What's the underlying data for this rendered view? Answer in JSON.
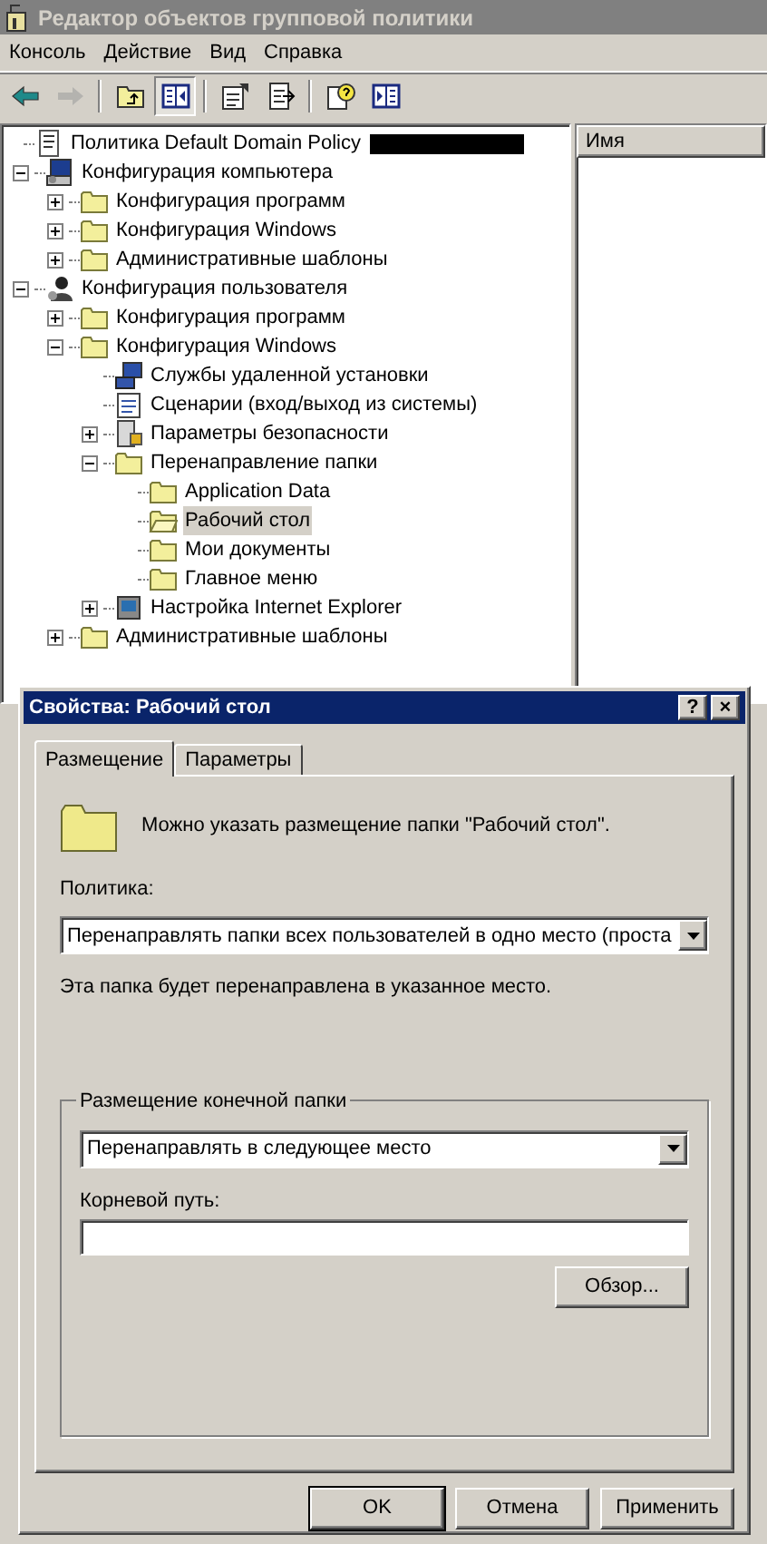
{
  "window": {
    "title": "Редактор объектов групповой политики"
  },
  "menu": [
    "Консоль",
    "Действие",
    "Вид",
    "Справка"
  ],
  "toolbar": [
    {
      "kind": "back",
      "disabled": false
    },
    {
      "kind": "forward",
      "disabled": true
    },
    {
      "kind": "sep"
    },
    {
      "kind": "up",
      "disabled": false
    },
    {
      "kind": "tree",
      "disabled": false,
      "pressed": true
    },
    {
      "kind": "sep"
    },
    {
      "kind": "props",
      "disabled": false
    },
    {
      "kind": "export",
      "disabled": false
    },
    {
      "kind": "sep"
    },
    {
      "kind": "help",
      "disabled": false
    },
    {
      "kind": "panel",
      "disabled": false
    }
  ],
  "tree": [
    {
      "label": "Политика Default Domain Policy",
      "kind": "policy",
      "redacted": true,
      "selected": false,
      "children": [
        {
          "label": "Конфигурация компьютера",
          "kind": "computer",
          "expanded": true,
          "selected": false,
          "children": [
            {
              "label": "Конфигурация программ",
              "kind": "folder",
              "expanded": false,
              "selected": false
            },
            {
              "label": "Конфигурация Windows",
              "kind": "folder",
              "expanded": false,
              "selected": false
            },
            {
              "label": "Административные шаблоны",
              "kind": "folder",
              "expanded": false,
              "selected": false
            }
          ]
        },
        {
          "label": "Конфигурация пользователя",
          "kind": "user",
          "expanded": true,
          "selected": false,
          "children": [
            {
              "label": "Конфигурация программ",
              "kind": "folder",
              "expanded": false,
              "selected": false
            },
            {
              "label": "Конфигурация Windows",
              "kind": "folder",
              "expanded": true,
              "selected": false,
              "children": [
                {
                  "label": "Службы удаленной установки",
                  "kind": "remote",
                  "selected": false
                },
                {
                  "label": "Сценарии (вход/выход из системы)",
                  "kind": "script",
                  "selected": false
                },
                {
                  "label": "Параметры безопасности",
                  "kind": "security",
                  "expanded": false,
                  "selected": false
                },
                {
                  "label": "Перенаправление папки",
                  "kind": "folder",
                  "expanded": true,
                  "selected": false,
                  "children": [
                    {
                      "label": "Application Data",
                      "kind": "folder",
                      "selected": false
                    },
                    {
                      "label": "Рабочий стол",
                      "kind": "folder",
                      "selected": true
                    },
                    {
                      "label": "Мои документы",
                      "kind": "folder",
                      "selected": false
                    },
                    {
                      "label": "Главное меню",
                      "kind": "folder",
                      "selected": false
                    }
                  ]
                },
                {
                  "label": "Настройка Internet Explorer",
                  "kind": "ie",
                  "expanded": false,
                  "selected": false
                }
              ]
            },
            {
              "label": "Административные шаблоны",
              "kind": "folder",
              "expanded": false,
              "selected": false
            }
          ]
        }
      ]
    }
  ],
  "list_columns": [
    "Имя"
  ],
  "dialog": {
    "title": "Свойства: Рабочий стол",
    "title_buttons": [
      "?",
      "×"
    ],
    "tabs": [
      {
        "label": "Размещение",
        "selected": true
      },
      {
        "label": "Параметры",
        "selected": false
      }
    ],
    "intro": "Можно указать размещение папки \"Рабочий стол\".",
    "policy_label": "Политика:",
    "policy_value": "Перенаправлять папки всех пользователей в одно место (проста",
    "policy_note": "Эта папка будет перенаправлена в указанное место.",
    "group": {
      "title": "Размещение конечной папки",
      "target_value": "Перенаправлять в следующее место",
      "root_label": "Корневой путь:",
      "browse": "Обзор..."
    },
    "buttons": [
      "OK",
      "Отмена",
      "Применить"
    ]
  }
}
